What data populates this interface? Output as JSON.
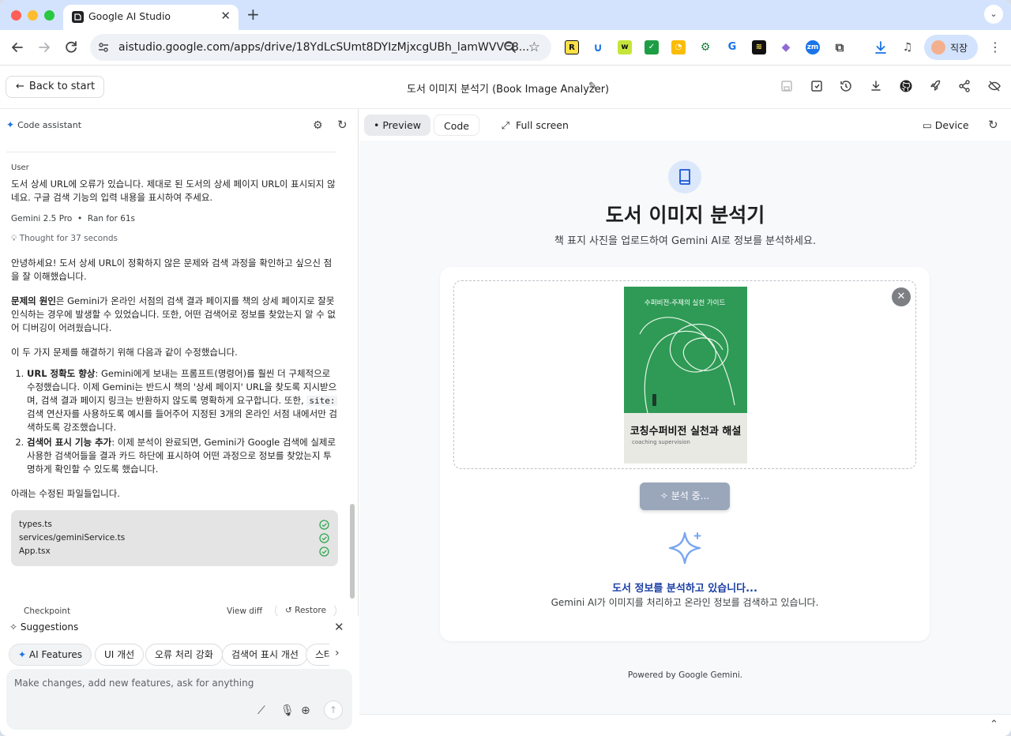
{
  "browser": {
    "tab_title": "Google AI Studio",
    "url": "aistudio.google.com/apps/drive/18YdLcSUmt8DYIzMjxcgUBh_lamWVVC8...",
    "profile_name": "직장",
    "ext_r_label": "R",
    "ext_zm_label": "zm"
  },
  "header": {
    "back_label": "Back to start",
    "title": "도서 이미지 분석기 (Book Image Analyzer)"
  },
  "assistant": {
    "title": "Code assistant",
    "user_role": "User",
    "user_message": "도서 상세 URL에 오류가 있습니다. 제대로 된 도서의 상세 페이지 URL이 표시되지 않네요. 구글 검색 기능의 입력 내용을 표시하여 주세요.",
    "model": "Gemini 2.5 Pro",
    "ran_for": "Ran for 61s",
    "thought": "Thought for 37 seconds",
    "intro": "안녕하세요! 도서 상세 URL이 정확하지 않은 문제와 검색 과정을 확인하고 싶으신 점을 잘 이해했습니다.",
    "cause_label": "문제의 원인",
    "cause_text": "은 Gemini가 온라인 서점의 검색 결과 페이지를 책의 상세 페이지로 잘못 인식하는 경우에 발생할 수 있었습니다. 또한, 어떤 검색어로 정보를 찾았는지 알 수 없어 디버깅이 어려웠습니다.",
    "fix_intro": "이 두 가지 문제를 해결하기 위해 다음과 같이 수정했습니다.",
    "item1_label": "URL 정확도 향상",
    "item1_text_a": ": Gemini에게 보내는 프롬프트(명령어)를 훨씬 더 구체적으로 수정했습니다. 이제 Gemini는 반드시 책의 '상세 페이지' URL을 찾도록 지시받으며, 검색 결과 페이지 링크는 반환하지 않도록 명확하게 요구합니다. 또한,",
    "item1_code": "site:",
    "item1_text_b": "검색 연산자를 사용하도록 예시를 들어주어 지정된 3개의 온라인 서점 내에서만 검색하도록 강조했습니다.",
    "item2_label": "검색어 표시 기능 추가",
    "item2_text": ": 이제 분석이 완료되면, Gemini가 Google 검색에 실제로 사용한 검색어들을 결과 카드 하단에 표시하여 어떤 과정으로 정보를 찾았는지 투명하게 확인할 수 있도록 했습니다.",
    "files_intro": "아래는 수정된 파일들입니다.",
    "files": [
      "types.ts",
      "services/geminiService.ts",
      "App.tsx"
    ],
    "checkpoint": "Checkpoint",
    "view_diff": "View diff",
    "restore": "Restore"
  },
  "suggestions": {
    "title": "Suggestions",
    "chips": [
      "AI Features",
      "UI 개선",
      "오류 처리 강화",
      "검색어 표시 개선",
      "스타"
    ]
  },
  "prompt": {
    "placeholder": "Make changes, add new features, ask for anything"
  },
  "preview_bar": {
    "preview": "Preview",
    "code": "Code",
    "full_screen": "Full screen",
    "device": "Device"
  },
  "app": {
    "title": "도서 이미지 분석기",
    "subtitle": "책 표지 사진을 업로드하여 Gemini AI로 정보를 분석하세요.",
    "book_caption": "수퍼비전-주제의 실천 가이드",
    "book_title": "코칭수퍼비전 실천과 해설",
    "book_subtitle": "coaching supervision",
    "analyze_button": "분석 중...",
    "status_title": "도서 정보를 분석하고 있습니다...",
    "status_sub": "Gemini AI가 이미지를 처리하고 온라인 정보를 검색하고 있습니다.",
    "powered_by": "Powered by Google Gemini."
  },
  "colors": {
    "accent": "#1a73e8",
    "status_title": "#1a3fa3",
    "book_green": "#2e9a55",
    "button_disabled": "#9aa6ba"
  }
}
